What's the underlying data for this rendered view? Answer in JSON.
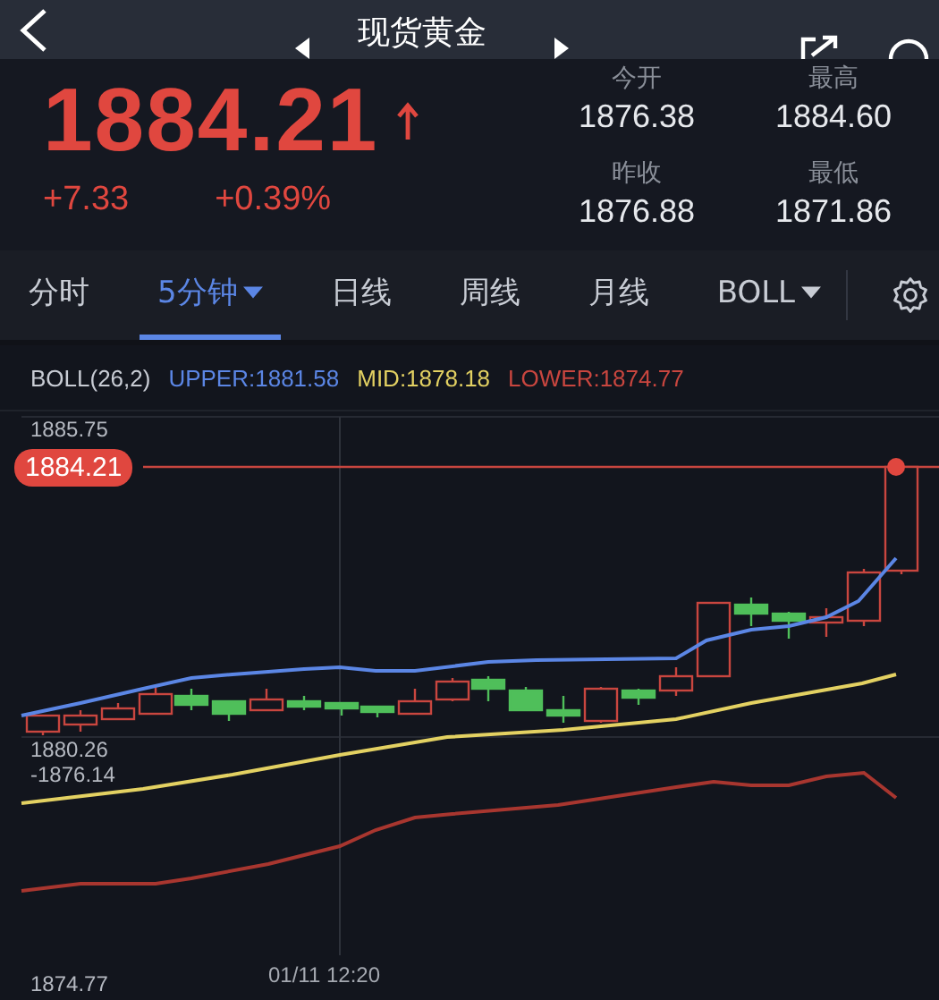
{
  "header": {
    "title": "现货黄金"
  },
  "quote": {
    "price": "1884.21",
    "change": "+7.33",
    "change_percent": "+0.39%"
  },
  "stats": [
    {
      "label": "今开",
      "value": "1876.38"
    },
    {
      "label": "最高",
      "value": "1884.60"
    },
    {
      "label": "昨收",
      "value": "1876.88"
    },
    {
      "label": "最低",
      "value": "1871.86"
    }
  ],
  "tabs": [
    {
      "label": "分时",
      "selected": false,
      "dropdown": false
    },
    {
      "label": "5分钟",
      "selected": true,
      "dropdown": true
    },
    {
      "label": "日线",
      "selected": false,
      "dropdown": false
    },
    {
      "label": "周线",
      "selected": false,
      "dropdown": false
    },
    {
      "label": "月线",
      "selected": false,
      "dropdown": false
    },
    {
      "label": "BOLL",
      "selected": false,
      "dropdown": true
    }
  ],
  "indicator": {
    "name": "BOLL(26,2)",
    "values": [
      {
        "label": "UPPER:1881.58",
        "color": "#5b86e5"
      },
      {
        "label": "MID:1878.18",
        "color": "#e3d162"
      },
      {
        "label": "LOWER:1874.77",
        "color": "#c9463f"
      }
    ]
  },
  "chart": {
    "y_labels": [
      "1885.75",
      "1880.26",
      "-1876.14",
      "1874.77"
    ],
    "last_price": "1884.21",
    "time_label": "01/11 12:20"
  }
}
